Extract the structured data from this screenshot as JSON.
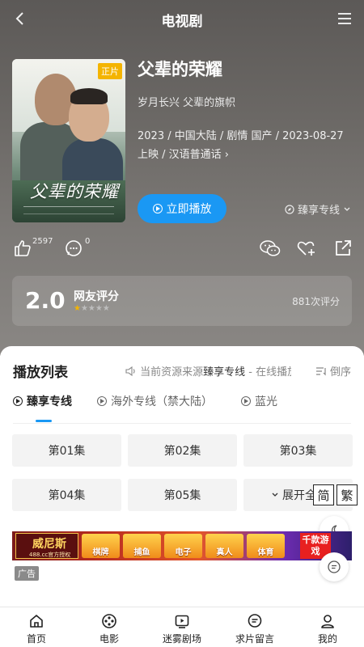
{
  "header": {
    "title": "电视剧"
  },
  "show": {
    "poster_badge": "正片",
    "poster_title": "父辈的荣耀",
    "title": "父辈的荣耀",
    "slogan": "岁月长兴 父辈的旗帜",
    "meta_line1": "2023 / 中国大陆 / 剧情 国产 / 2023-08-27",
    "meta_line2": "上映 / 汉语普通话 ›",
    "play_label": "立即播放",
    "line_label": "臻享专线"
  },
  "actions": {
    "like_count": "2597",
    "comment_count": "0"
  },
  "rating": {
    "score": "2.0",
    "label": "网友评分",
    "stars_filled": 1,
    "stars_total": 5,
    "count": "881次评分"
  },
  "playlist": {
    "title": "播放列表",
    "source_prefix": "当前资源来源",
    "source_name": "臻享专线",
    "source_suffix": " - 在线播放",
    "sort_label": "倒序",
    "tabs": [
      {
        "label": "臻享专线",
        "active": true
      },
      {
        "label": "海外专线（禁大陆）",
        "active": false
      },
      {
        "label": "蓝光",
        "active": false
      }
    ],
    "episodes": [
      "第01集",
      "第02集",
      "第03集",
      "第04集",
      "第05集"
    ],
    "expand_label": "展开全部"
  },
  "convert": {
    "simplified": "简",
    "traditional": "繁"
  },
  "ad": {
    "brand": "威尼斯",
    "brand_sub": "488.cc官方授权",
    "tiles": [
      "棋牌",
      "捕鱼",
      "电子",
      "真人",
      "体育"
    ],
    "promo": "千款游戏",
    "tag": "广告"
  },
  "bottom_nav": [
    {
      "label": "首页",
      "icon": "home-icon"
    },
    {
      "label": "电影",
      "icon": "film-reel-icon"
    },
    {
      "label": "迷雾剧场",
      "icon": "play-screen-icon"
    },
    {
      "label": "求片留言",
      "icon": "message-icon"
    },
    {
      "label": "我的",
      "icon": "user-icon"
    }
  ],
  "colors": {
    "accent": "#1a98f4",
    "badge": "#f4b400"
  }
}
